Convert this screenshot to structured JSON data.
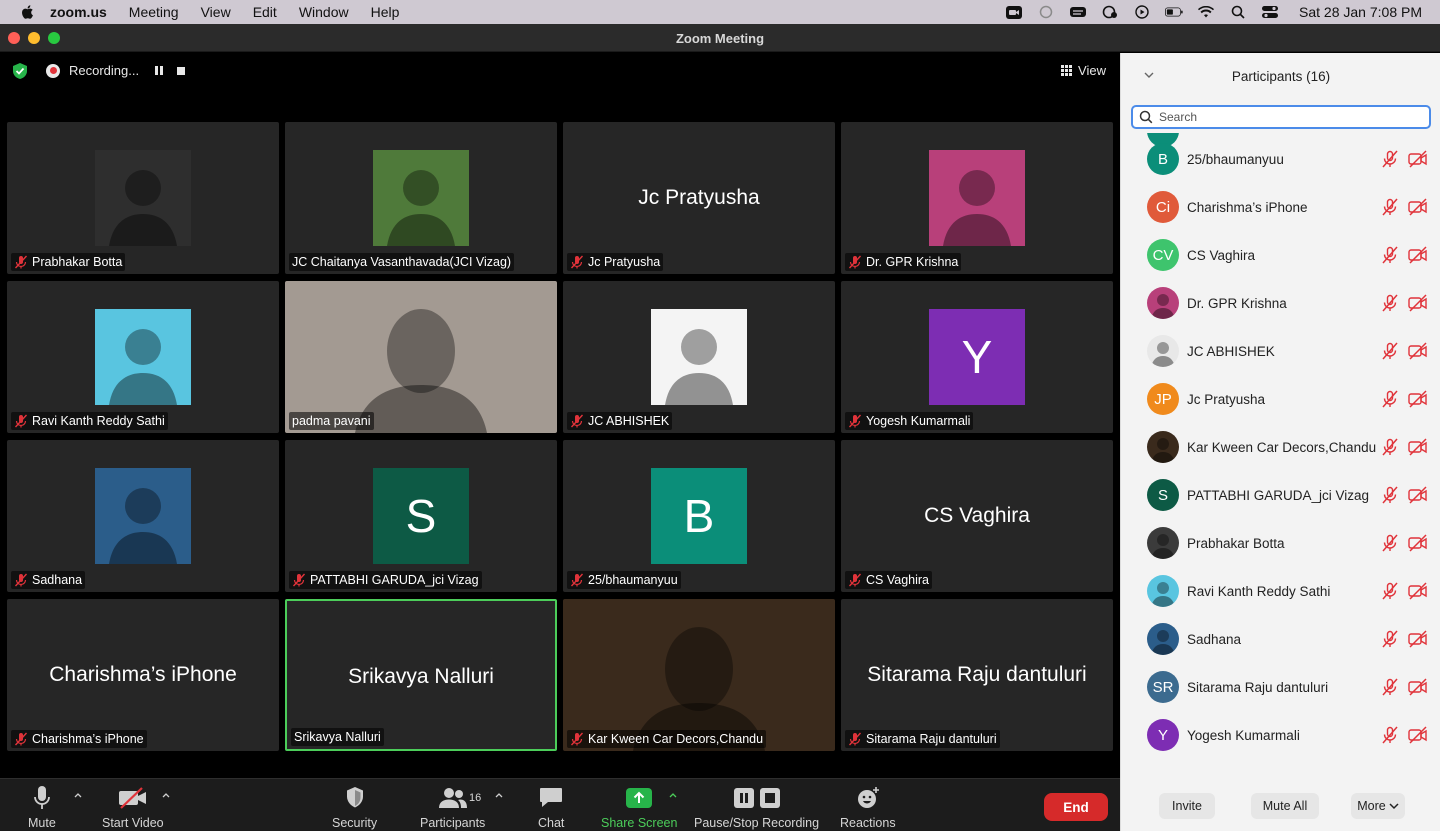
{
  "menubar": {
    "app": "zoom.us",
    "items": [
      "Meeting",
      "View",
      "Edit",
      "Window",
      "Help"
    ],
    "clock": "Sat 28 Jan  7:08 PM"
  },
  "window": {
    "title": "Zoom Meeting"
  },
  "topbar": {
    "recording_label": "Recording...",
    "view_label": "View"
  },
  "tiles": [
    {
      "name": "Prabhakar Botta",
      "kind": "photo",
      "color": "#2e2e2e",
      "muted": true
    },
    {
      "name": "JC Chaitanya Vasanthavada(JCI Vizag)",
      "kind": "photo",
      "color": "#4f7a3a",
      "muted": false
    },
    {
      "name": "Jc Pratyusha",
      "kind": "text",
      "big": "Jc Pratyusha",
      "muted": true
    },
    {
      "name": "Dr. GPR Krishna",
      "kind": "photo",
      "color": "#b8407a",
      "muted": true
    },
    {
      "name": "Ravi Kanth Reddy Sathi",
      "kind": "photo",
      "color": "#59c5e0",
      "muted": true
    },
    {
      "name": "padma pavani",
      "kind": "video",
      "color": "#a39a92",
      "muted": false
    },
    {
      "name": "JC ABHISHEK",
      "kind": "photo",
      "color": "#f4f4f4",
      "muted": true
    },
    {
      "name": "Yogesh Kumarmali",
      "kind": "letter",
      "letter": "Y",
      "color": "#7d2db3",
      "muted": true
    },
    {
      "name": "Sadhana",
      "kind": "photo",
      "color": "#2b5d8a",
      "muted": true
    },
    {
      "name": "PATTABHI GARUDA_jci Vizag",
      "kind": "letter",
      "letter": "S",
      "color": "#0d5a45",
      "muted": true
    },
    {
      "name": "25/bhaumanyuu",
      "kind": "letter",
      "letter": "B",
      "color": "#0b8e79",
      "muted": true
    },
    {
      "name": "CS Vaghira",
      "kind": "text",
      "big": "CS Vaghira",
      "muted": true
    },
    {
      "name": "Charishma’s iPhone",
      "kind": "text",
      "big": "Charishma’s iPhone",
      "muted": true
    },
    {
      "name": "Srikavya Nalluri",
      "kind": "text",
      "big": "Srikavya Nalluri",
      "muted": false,
      "active": true
    },
    {
      "name": "Kar Kween Car Decors,Chandu",
      "kind": "video",
      "color": "#3a2a1c",
      "muted": true
    },
    {
      "name": "Sitarama Raju dantuluri",
      "kind": "text",
      "big": "Sitarama Raju dantuluri",
      "muted": true
    }
  ],
  "toolbar": {
    "mute": "Mute",
    "start_video": "Start Video",
    "security": "Security",
    "participants": "Participants",
    "participants_count": "16",
    "chat": "Chat",
    "share_screen": "Share Screen",
    "pause_stop_recording": "Pause/Stop Recording",
    "reactions": "Reactions",
    "end": "End"
  },
  "panel": {
    "title": "Participants (16)",
    "search_placeholder": "Search",
    "participants": [
      {
        "name": "25/bhaumanyuu",
        "initials": "B",
        "color": "#0b8e79"
      },
      {
        "name": "Charishma’s iPhone",
        "initials": "Ci",
        "color": "#e05a3a"
      },
      {
        "name": "CS Vaghira",
        "initials": "CV",
        "color": "#3ec46d"
      },
      {
        "name": "Dr. GPR Krishna",
        "initials": "",
        "color": "#b8407a"
      },
      {
        "name": "JC ABHISHEK",
        "initials": "",
        "color": "#e8e8e8"
      },
      {
        "name": "Jc Pratyusha",
        "initials": "JP",
        "color": "#f08a1c"
      },
      {
        "name": "Kar Kween Car Decors,Chandu",
        "initials": "",
        "color": "#3a2a1c"
      },
      {
        "name": "PATTABHI GARUDA_jci Vizag",
        "initials": "S",
        "color": "#0d5a45"
      },
      {
        "name": "Prabhakar Botta",
        "initials": "",
        "color": "#3b3b3b"
      },
      {
        "name": "Ravi Kanth Reddy Sathi",
        "initials": "",
        "color": "#59c5e0"
      },
      {
        "name": "Sadhana",
        "initials": "",
        "color": "#2b5d8a"
      },
      {
        "name": "Sitarama Raju dantuluri",
        "initials": "SR",
        "color": "#3c6b8f"
      },
      {
        "name": "Yogesh Kumarmali",
        "initials": "Y",
        "color": "#7d2db3"
      }
    ],
    "invite": "Invite",
    "mute_all": "Mute All",
    "more": "More"
  }
}
